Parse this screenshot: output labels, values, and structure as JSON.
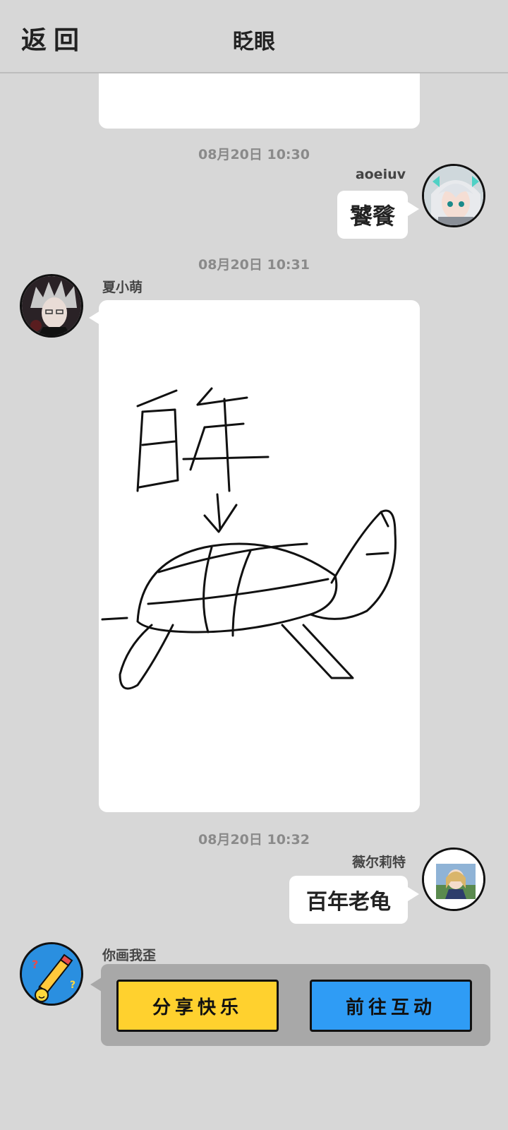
{
  "header": {
    "back_label": "返回",
    "title": "眨眼"
  },
  "messages": [
    {
      "time": "08月20日 10:30",
      "sender": "aoeiuv",
      "text": "饕餮"
    },
    {
      "time": "08月20日 10:31",
      "sender": "夏小萌",
      "drawing_text": "百年"
    },
    {
      "time": "08月20日 10:32",
      "sender": "薇尔莉特",
      "text": "百年老龟"
    }
  ],
  "bot": {
    "sender": "你画我歪",
    "buttons": [
      {
        "label": "分享快乐",
        "color": "#ffd12e"
      },
      {
        "label": "前往互动",
        "color": "#2f9cf5"
      }
    ]
  }
}
